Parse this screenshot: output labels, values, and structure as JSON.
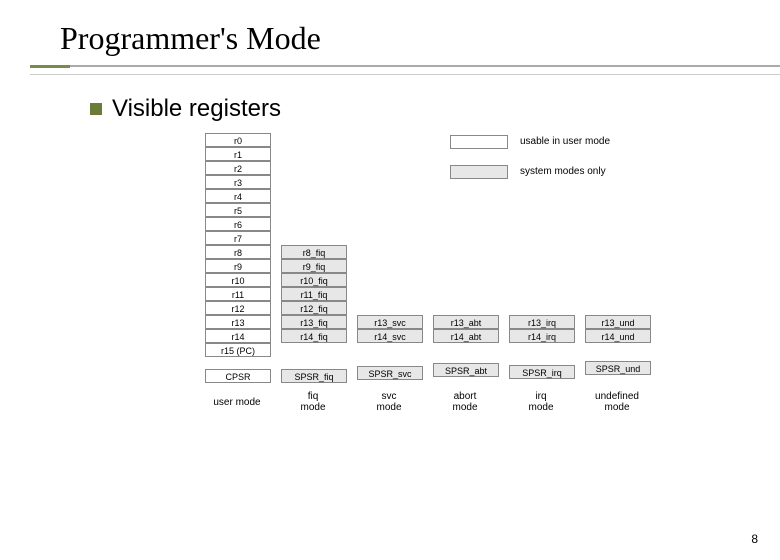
{
  "title": "Programmer's Mode",
  "subtitle": "Visible registers",
  "legend": {
    "usable": "usable in user mode",
    "system": "system modes only"
  },
  "user_regs": [
    "r0",
    "r1",
    "r2",
    "r3",
    "r4",
    "r5",
    "r6",
    "r7",
    "r8",
    "r9",
    "r10",
    "r11",
    "r12",
    "r13",
    "r14",
    "r15 (PC)"
  ],
  "fiq_regs": [
    "r8_fiq",
    "r9_fiq",
    "r10_fiq",
    "r11_fiq",
    "r12_fiq",
    "r13_fiq",
    "r14_fiq"
  ],
  "svc_regs": [
    "r13_svc",
    "r14_svc"
  ],
  "abt_regs": [
    "r13_abt",
    "r14_abt"
  ],
  "irq_regs": [
    "r13_irq",
    "r14_irq"
  ],
  "und_regs": [
    "r13_und",
    "r14_und"
  ],
  "cpsr": "CPSR",
  "spsr": [
    "SPSR_fiq",
    "SPSR_svc",
    "SPSR_abt",
    "SPSR_irq",
    "SPSR_und"
  ],
  "mode_labels": {
    "user": "user mode",
    "fiq": "fiq\nmode",
    "svc": "svc\nmode",
    "abort": "abort\nmode",
    "irq": "irq\nmode",
    "und": "undefined\nmode"
  },
  "page_number": "8"
}
